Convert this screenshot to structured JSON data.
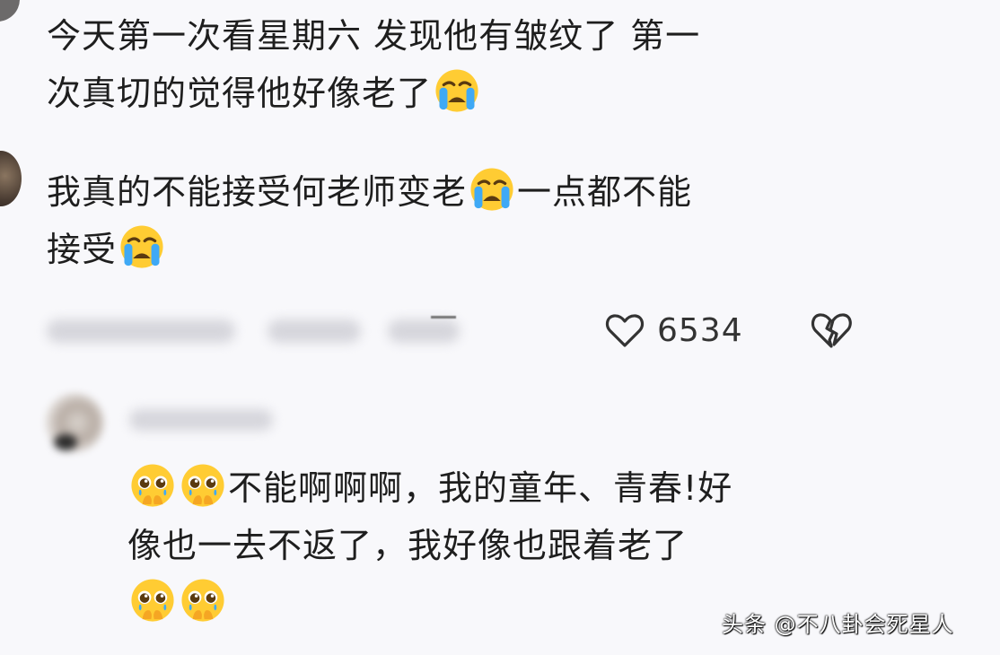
{
  "comments": [
    {
      "lines": [
        "今天第一次看星期六 发现他有皱纹了 第一",
        "次真切的觉得他好像老了"
      ],
      "emoji": "loudly-crying-face"
    },
    {
      "line1_a": "我真的不能接受何老师变老",
      "line1_b": "一点都不能",
      "line2": "接受",
      "emoji": "loudly-crying-face",
      "likes": "6534"
    },
    {
      "line1": "不能啊啊啊，我的童年、青春!好",
      "line2": "像也一去不返了，我好像也跟着老了",
      "emoji": "pleading-face-holding-back-tears"
    }
  ],
  "icons": {
    "like": "heart-outline-icon",
    "dislike": "broken-heart-icon"
  },
  "watermark": "头条 @不八卦会死星人",
  "colors": {
    "background": "#f8f8fb",
    "text": "#1e1e1e",
    "icon": "#333333",
    "emoji_face": "#ffcc33",
    "emoji_tear": "#3fa9f5"
  }
}
